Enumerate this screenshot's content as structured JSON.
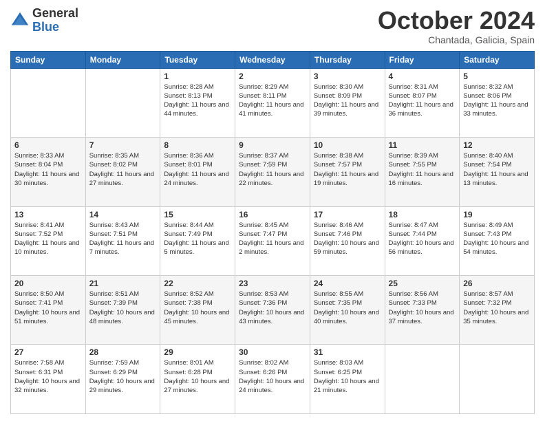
{
  "logo": {
    "general": "General",
    "blue": "Blue"
  },
  "header": {
    "month": "October 2024",
    "location": "Chantada, Galicia, Spain"
  },
  "days_of_week": [
    "Sunday",
    "Monday",
    "Tuesday",
    "Wednesday",
    "Thursday",
    "Friday",
    "Saturday"
  ],
  "weeks": [
    [
      {
        "day": "",
        "info": ""
      },
      {
        "day": "",
        "info": ""
      },
      {
        "day": "1",
        "info": "Sunrise: 8:28 AM\nSunset: 8:13 PM\nDaylight: 11 hours and 44 minutes."
      },
      {
        "day": "2",
        "info": "Sunrise: 8:29 AM\nSunset: 8:11 PM\nDaylight: 11 hours and 41 minutes."
      },
      {
        "day": "3",
        "info": "Sunrise: 8:30 AM\nSunset: 8:09 PM\nDaylight: 11 hours and 39 minutes."
      },
      {
        "day": "4",
        "info": "Sunrise: 8:31 AM\nSunset: 8:07 PM\nDaylight: 11 hours and 36 minutes."
      },
      {
        "day": "5",
        "info": "Sunrise: 8:32 AM\nSunset: 8:06 PM\nDaylight: 11 hours and 33 minutes."
      }
    ],
    [
      {
        "day": "6",
        "info": "Sunrise: 8:33 AM\nSunset: 8:04 PM\nDaylight: 11 hours and 30 minutes."
      },
      {
        "day": "7",
        "info": "Sunrise: 8:35 AM\nSunset: 8:02 PM\nDaylight: 11 hours and 27 minutes."
      },
      {
        "day": "8",
        "info": "Sunrise: 8:36 AM\nSunset: 8:01 PM\nDaylight: 11 hours and 24 minutes."
      },
      {
        "day": "9",
        "info": "Sunrise: 8:37 AM\nSunset: 7:59 PM\nDaylight: 11 hours and 22 minutes."
      },
      {
        "day": "10",
        "info": "Sunrise: 8:38 AM\nSunset: 7:57 PM\nDaylight: 11 hours and 19 minutes."
      },
      {
        "day": "11",
        "info": "Sunrise: 8:39 AM\nSunset: 7:55 PM\nDaylight: 11 hours and 16 minutes."
      },
      {
        "day": "12",
        "info": "Sunrise: 8:40 AM\nSunset: 7:54 PM\nDaylight: 11 hours and 13 minutes."
      }
    ],
    [
      {
        "day": "13",
        "info": "Sunrise: 8:41 AM\nSunset: 7:52 PM\nDaylight: 11 hours and 10 minutes."
      },
      {
        "day": "14",
        "info": "Sunrise: 8:43 AM\nSunset: 7:51 PM\nDaylight: 11 hours and 7 minutes."
      },
      {
        "day": "15",
        "info": "Sunrise: 8:44 AM\nSunset: 7:49 PM\nDaylight: 11 hours and 5 minutes."
      },
      {
        "day": "16",
        "info": "Sunrise: 8:45 AM\nSunset: 7:47 PM\nDaylight: 11 hours and 2 minutes."
      },
      {
        "day": "17",
        "info": "Sunrise: 8:46 AM\nSunset: 7:46 PM\nDaylight: 10 hours and 59 minutes."
      },
      {
        "day": "18",
        "info": "Sunrise: 8:47 AM\nSunset: 7:44 PM\nDaylight: 10 hours and 56 minutes."
      },
      {
        "day": "19",
        "info": "Sunrise: 8:49 AM\nSunset: 7:43 PM\nDaylight: 10 hours and 54 minutes."
      }
    ],
    [
      {
        "day": "20",
        "info": "Sunrise: 8:50 AM\nSunset: 7:41 PM\nDaylight: 10 hours and 51 minutes."
      },
      {
        "day": "21",
        "info": "Sunrise: 8:51 AM\nSunset: 7:39 PM\nDaylight: 10 hours and 48 minutes."
      },
      {
        "day": "22",
        "info": "Sunrise: 8:52 AM\nSunset: 7:38 PM\nDaylight: 10 hours and 45 minutes."
      },
      {
        "day": "23",
        "info": "Sunrise: 8:53 AM\nSunset: 7:36 PM\nDaylight: 10 hours and 43 minutes."
      },
      {
        "day": "24",
        "info": "Sunrise: 8:55 AM\nSunset: 7:35 PM\nDaylight: 10 hours and 40 minutes."
      },
      {
        "day": "25",
        "info": "Sunrise: 8:56 AM\nSunset: 7:33 PM\nDaylight: 10 hours and 37 minutes."
      },
      {
        "day": "26",
        "info": "Sunrise: 8:57 AM\nSunset: 7:32 PM\nDaylight: 10 hours and 35 minutes."
      }
    ],
    [
      {
        "day": "27",
        "info": "Sunrise: 7:58 AM\nSunset: 6:31 PM\nDaylight: 10 hours and 32 minutes."
      },
      {
        "day": "28",
        "info": "Sunrise: 7:59 AM\nSunset: 6:29 PM\nDaylight: 10 hours and 29 minutes."
      },
      {
        "day": "29",
        "info": "Sunrise: 8:01 AM\nSunset: 6:28 PM\nDaylight: 10 hours and 27 minutes."
      },
      {
        "day": "30",
        "info": "Sunrise: 8:02 AM\nSunset: 6:26 PM\nDaylight: 10 hours and 24 minutes."
      },
      {
        "day": "31",
        "info": "Sunrise: 8:03 AM\nSunset: 6:25 PM\nDaylight: 10 hours and 21 minutes."
      },
      {
        "day": "",
        "info": ""
      },
      {
        "day": "",
        "info": ""
      }
    ]
  ]
}
